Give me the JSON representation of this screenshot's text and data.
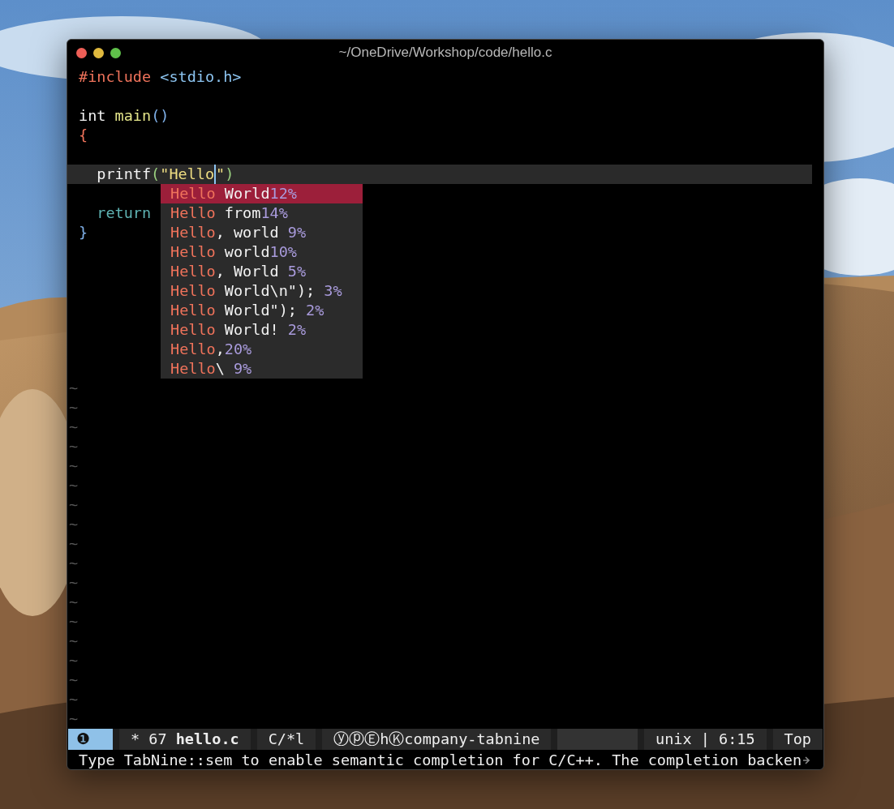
{
  "window": {
    "title": "~/OneDrive/Workshop/code/hello.c",
    "buttons": [
      {
        "kind": "close"
      },
      {
        "kind": "minimize"
      },
      {
        "kind": "zoom"
      }
    ]
  },
  "editor": {
    "lines": [
      {
        "current": false,
        "tokens": [
          {
            "text": "#include ",
            "kind": "preproc",
            "cursor": false
          },
          {
            "text": "<stdio.h>",
            "kind": "header",
            "cursor": false
          }
        ]
      },
      {
        "current": false
      },
      {
        "current": false,
        "tokens": [
          {
            "text": "int ",
            "kind": "plain",
            "cursor": false
          },
          {
            "text": "main",
            "kind": "func",
            "cursor": false
          },
          {
            "text": "()",
            "kind": "paren",
            "cursor": false
          }
        ]
      },
      {
        "current": false,
        "tokens": [
          {
            "text": "{",
            "kind": "brace",
            "cursor": false
          }
        ]
      },
      {
        "current": false
      },
      {
        "current": true,
        "tokens": [
          {
            "text": "  printf",
            "kind": "plain",
            "cursor": false
          },
          {
            "text": "(",
            "kind": "paren2",
            "cursor": false
          },
          {
            "text": "\"Hello",
            "kind": "string",
            "cursor": true
          },
          {
            "text": "\"",
            "kind": "string",
            "cursor": false
          },
          {
            "text": ")",
            "kind": "paren2",
            "cursor": false
          }
        ]
      },
      {
        "current": false
      },
      {
        "current": false,
        "tokens": [
          {
            "text": "  return",
            "kind": "keyword",
            "cursor": false
          }
        ]
      },
      {
        "current": false,
        "tokens": [
          {
            "text": "}",
            "kind": "paren",
            "cursor": false
          }
        ]
      },
      {
        "current": false
      },
      {
        "current": false
      },
      {
        "current": false
      },
      {
        "current": false
      },
      {
        "current": false
      },
      {
        "current": false
      },
      {
        "current": false
      }
    ],
    "tildes": [
      "~",
      "~",
      "~",
      "~",
      "~",
      "~",
      "~",
      "~",
      "~",
      "~",
      "~",
      "~",
      "~",
      "~",
      "~",
      "~",
      "~",
      "~"
    ]
  },
  "completion": [
    {
      "prefix": "Hello",
      "rest": " World",
      "score": "12%",
      "selected": true
    },
    {
      "prefix": "Hello",
      "rest": " from",
      "score": "14%",
      "selected": false
    },
    {
      "prefix": "Hello",
      "rest": ", world ",
      "score": "9%",
      "selected": false
    },
    {
      "prefix": "Hello",
      "rest": " world",
      "score": "10%",
      "selected": false
    },
    {
      "prefix": "Hello",
      "rest": ", World ",
      "score": "5%",
      "selected": false
    },
    {
      "prefix": "Hello",
      "rest": " World\\n\"); ",
      "score": "3%",
      "selected": false
    },
    {
      "prefix": "Hello",
      "rest": " World\"); ",
      "score": "2%",
      "selected": false
    },
    {
      "prefix": "Hello",
      "rest": " World! ",
      "score": "2%",
      "selected": false
    },
    {
      "prefix": "Hello",
      "rest": ",",
      "score": "20%",
      "selected": false
    },
    {
      "prefix": "Hello",
      "rest": "\\ ",
      "score": "9%",
      "selected": false
    }
  ],
  "status_bar": {
    "window_number": "❶",
    "modified": "*",
    "size": "67",
    "buffer": "hello.c",
    "mode": "C/*l",
    "minor_modes": "ⓨⓟⒺhⓀcompany-tabnine",
    "eol": "unix | 6:15",
    "position": "Top"
  },
  "echo_area": {
    "message": "Type TabNine::sem to enable semantic completion for C/C++. The completion backen",
    "truncated": true
  }
}
